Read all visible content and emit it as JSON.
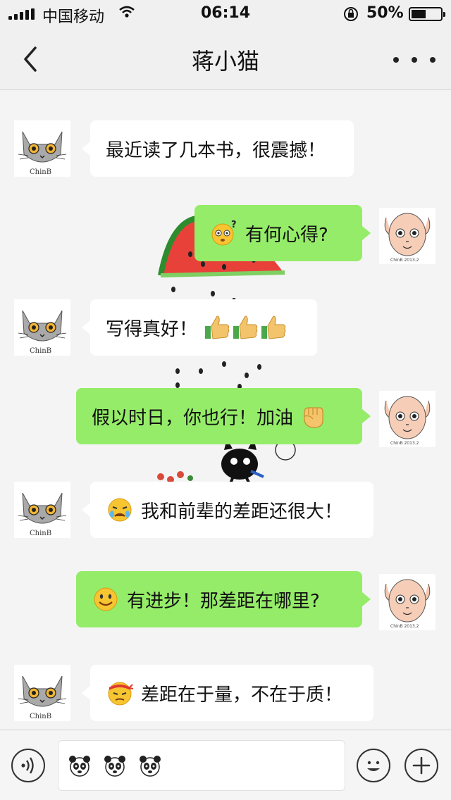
{
  "status_bar": {
    "carrier": "中国移动",
    "time": "06:14",
    "battery_percent": "50%",
    "battery_level": 0.5
  },
  "nav": {
    "title": "蒋小猫",
    "back_icon": "chevron-left-icon",
    "more_icon": "ellipsis-icon"
  },
  "avatars": {
    "left_caption": "ChinB",
    "right_caption": "ChinB 2013.2"
  },
  "messages": [
    {
      "side": "left",
      "text": "最近读了几本书，很震撼！"
    },
    {
      "side": "right",
      "text": "有何心得?",
      "emoji_before": "dizzy-face-emoji"
    },
    {
      "side": "left",
      "text": "写得真好！",
      "emoji_after": "thumbs-up-emoji x3"
    },
    {
      "side": "right",
      "text": "假以时日，你也行！加油",
      "emoji_after": "raised-fist-emoji"
    },
    {
      "side": "left",
      "text": "我和前辈的差距还很大！",
      "emoji_before": "crying-face-emoji"
    },
    {
      "side": "right",
      "text": "有进步！那差距在哪里?",
      "emoji_before": "smiling-face-emoji"
    },
    {
      "side": "left",
      "text": "差距在于量，不在于质！",
      "emoji_before": "headband-determined-face-emoji"
    }
  ],
  "input_bar": {
    "voice_icon": "voice-icon",
    "emoji_icon": "smiley-icon",
    "plus_icon": "plus-icon",
    "draft_stickers": [
      "panda-sticker",
      "panda-sticker",
      "panda-sticker"
    ]
  },
  "colors": {
    "sent_bubble": "#95ec69",
    "received_bubble": "#ffffff",
    "chat_background": "#f4f4f4"
  }
}
